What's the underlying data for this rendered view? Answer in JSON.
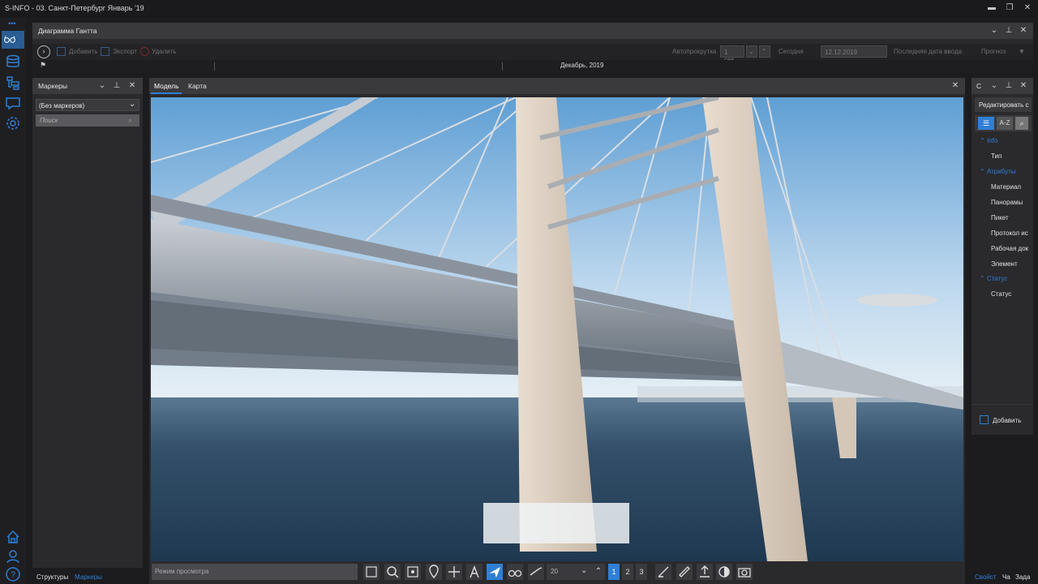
{
  "window": {
    "title": "S-INFO - 03. Санкт-Петербург Январь '19"
  },
  "gantt": {
    "title": "Диаграмма Гантта",
    "toolbar": {
      "add": "Добавить",
      "export": "Экспорт",
      "delete": "Удалить",
      "autoscroll_label": "Автопрокрутка",
      "autoscroll_value": "1 сек.",
      "today_label": "Сегодня",
      "date_value": "12.12.2019",
      "last_date_label": "Последняя дата ввода",
      "forecast_label": "Прогноз"
    },
    "month_label": "Декабрь, 2019"
  },
  "markers": {
    "title": "Маркеры",
    "select_value": "(Без маркеров)",
    "search_placeholder": "Поиск"
  },
  "viewer": {
    "tabs": [
      "Модель",
      "Карта"
    ],
    "mode_placeholder": "Режим просмотра",
    "speed_value": "20",
    "pages": [
      "1",
      "2",
      "3"
    ]
  },
  "props": {
    "title": "С",
    "edit_label": "Редактировать с",
    "sort_az": "A-Z",
    "categories": [
      {
        "name": "Info",
        "items": [
          "Тип"
        ]
      },
      {
        "name": "Атрибуты",
        "items": [
          "Материал",
          "Панорамы",
          "Пикет",
          "Протокол ис",
          "Рабочая док",
          "Элемент"
        ]
      },
      {
        "name": "Статус",
        "items": [
          "Статус"
        ]
      }
    ],
    "add_button": "Добавить"
  },
  "bottom": {
    "tabs_left": [
      "Структуры",
      "Маркеры"
    ],
    "tabs_right": [
      "Свойст",
      "Ча",
      "Задa"
    ]
  },
  "colors": {
    "accent": "#2f7fd6",
    "sky_top": "#5f9fd4",
    "water": "#2a4a66"
  }
}
